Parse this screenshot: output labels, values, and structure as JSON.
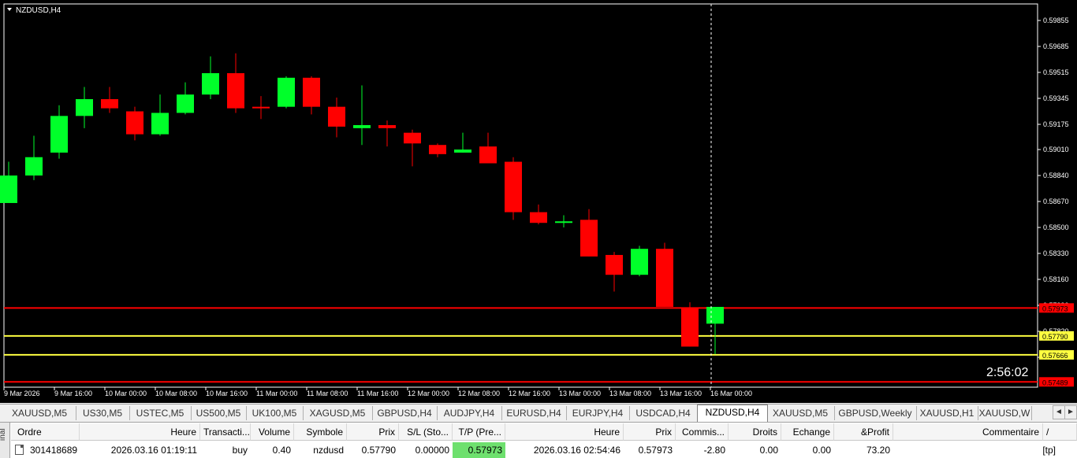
{
  "chart": {
    "symbol_label": "NZDUSD,H4",
    "countdown": "2:56:02",
    "colors": {
      "bg": "#000000",
      "bull": "#00ff2a",
      "bear": "#ff0000",
      "wick": "#ffffff",
      "tp_line": "#ff0000",
      "entry_line": "#ffff40",
      "sl_line": "#ff0000",
      "grid_text": "#ffffff"
    },
    "price_ticks": [
      "0.59855",
      "0.59685",
      "0.59515",
      "0.59345",
      "0.59175",
      "0.59010",
      "0.58840",
      "0.58670",
      "0.58500",
      "0.58330",
      "0.58160",
      "0.57990",
      "0.57820",
      "0.57650"
    ],
    "time_ticks": [
      "9 Mar 2026",
      "9 Mar 16:00",
      "10 Mar 00:00",
      "10 Mar 08:00",
      "10 Mar 16:00",
      "11 Mar 00:00",
      "11 Mar 08:00",
      "11 Mar 16:00",
      "12 Mar 00:00",
      "12 Mar 08:00",
      "12 Mar 16:00",
      "13 Mar 00:00",
      "13 Mar 08:00",
      "13 Mar 16:00",
      "16 Mar 00:00"
    ],
    "price_tags": [
      {
        "text": "0.57973",
        "value": 0.57973,
        "kind": "tp"
      },
      {
        "text": "0.57790",
        "value": 0.5779,
        "kind": "entry"
      },
      {
        "text": "0.57666",
        "value": 0.57666,
        "kind": "entry"
      },
      {
        "text": "0.57489",
        "value": 0.57489,
        "kind": "sl"
      }
    ],
    "candles": [
      {
        "o": 0.5866,
        "h": 0.5893,
        "l": 0.5867,
        "c": 0.5884
      },
      {
        "o": 0.5884,
        "h": 0.591,
        "l": 0.5881,
        "c": 0.5896
      },
      {
        "o": 0.5899,
        "h": 0.593,
        "l": 0.5895,
        "c": 0.5923
      },
      {
        "o": 0.5923,
        "h": 0.5942,
        "l": 0.5915,
        "c": 0.5934
      },
      {
        "o": 0.5934,
        "h": 0.5942,
        "l": 0.5925,
        "c": 0.5928
      },
      {
        "o": 0.5926,
        "h": 0.5929,
        "l": 0.5907,
        "c": 0.5911
      },
      {
        "o": 0.5911,
        "h": 0.5937,
        "l": 0.591,
        "c": 0.5925
      },
      {
        "o": 0.5925,
        "h": 0.5945,
        "l": 0.5924,
        "c": 0.5937
      },
      {
        "o": 0.5937,
        "h": 0.5962,
        "l": 0.5934,
        "c": 0.5951
      },
      {
        "o": 0.5951,
        "h": 0.5964,
        "l": 0.5925,
        "c": 0.5928
      },
      {
        "o": 0.5929,
        "h": 0.5936,
        "l": 0.5921,
        "c": 0.5928
      },
      {
        "o": 0.5929,
        "h": 0.5949,
        "l": 0.5928,
        "c": 0.5948
      },
      {
        "o": 0.5948,
        "h": 0.5949,
        "l": 0.5924,
        "c": 0.5929
      },
      {
        "o": 0.5929,
        "h": 0.5935,
        "l": 0.5909,
        "c": 0.5916
      },
      {
        "o": 0.5915,
        "h": 0.5943,
        "l": 0.5904,
        "c": 0.5917
      },
      {
        "o": 0.5917,
        "h": 0.592,
        "l": 0.5903,
        "c": 0.5915
      },
      {
        "o": 0.5912,
        "h": 0.5914,
        "l": 0.589,
        "c": 0.5905
      },
      {
        "o": 0.5904,
        "h": 0.5905,
        "l": 0.5896,
        "c": 0.5898
      },
      {
        "o": 0.5899,
        "h": 0.5912,
        "l": 0.5899,
        "c": 0.5901
      },
      {
        "o": 0.5903,
        "h": 0.5912,
        "l": 0.5893,
        "c": 0.5892
      },
      {
        "o": 0.5893,
        "h": 0.5896,
        "l": 0.5855,
        "c": 0.586
      },
      {
        "o": 0.586,
        "h": 0.5865,
        "l": 0.5852,
        "c": 0.5853
      },
      {
        "o": 0.5854,
        "h": 0.5858,
        "l": 0.585,
        "c": 0.5854
      },
      {
        "o": 0.5855,
        "h": 0.5862,
        "l": 0.5831,
        "c": 0.5831
      },
      {
        "o": 0.5832,
        "h": 0.5834,
        "l": 0.5808,
        "c": 0.5819
      },
      {
        "o": 0.5819,
        "h": 0.5838,
        "l": 0.5818,
        "c": 0.5836
      },
      {
        "o": 0.5836,
        "h": 0.584,
        "l": 0.5798,
        "c": 0.5798
      },
      {
        "o": 0.5797,
        "h": 0.5801,
        "l": 0.5772,
        "c": 0.5772
      },
      {
        "o": 0.5787,
        "h": 0.5798,
        "l": 0.5767,
        "c": 0.5798
      }
    ]
  },
  "tabs": [
    "XAUUSD,M5",
    "US30,M5",
    "USTEC,M5",
    "US500,M5",
    "UK100,M5",
    "XAGUSD,M5",
    "GBPUSD,H4",
    "AUDJPY,H4",
    "EURUSD,H4",
    "EURJPY,H4",
    "USDCAD,H4",
    "NZDUSD,H4",
    "XAUUSD,M5",
    "GBPUSD,Weekly",
    "XAUUSD,H1",
    "XAUUSD,W"
  ],
  "active_tab_index": 11,
  "nav": {
    "prev": "◄",
    "next": "►"
  },
  "terminal": {
    "side_label": "inal",
    "headers": [
      "Ordre",
      "Heure",
      "Transacti...",
      "Volume",
      "Symbole",
      "Prix",
      "S/L (Sto...",
      "T/P (Pre...",
      "Heure",
      "Prix",
      "Commis...",
      "Droits",
      "Echange",
      "&Profit",
      "Commentaire",
      "/"
    ],
    "row": [
      "301418689",
      "2026.03.16 01:19:11",
      "buy",
      "0.40",
      "nzdusd",
      "0.57790",
      "0.00000",
      "0.57973",
      "2026.03.16 02:54:46",
      "0.57973",
      "-2.80",
      "0.00",
      "0.00",
      "73.20",
      "[tp]"
    ]
  }
}
